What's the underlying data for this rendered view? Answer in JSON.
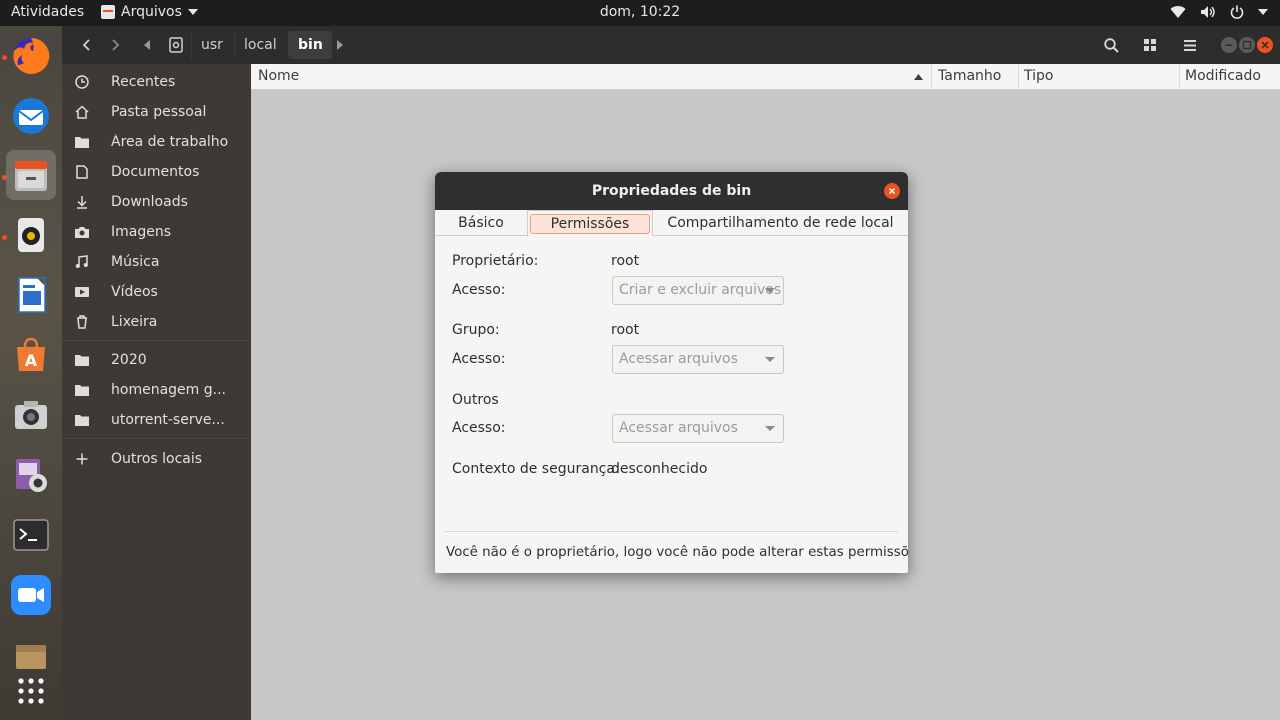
{
  "topbar": {
    "activities": "Atividades",
    "app_menu": "Arquivos",
    "clock": "dom, 10:22"
  },
  "dock": {
    "items": [
      "firefox-icon",
      "thunderbird-icon",
      "files-icon",
      "rhythmbox-icon",
      "libreoffice-writer-icon",
      "ubuntu-software-icon",
      "screenshot-icon",
      "cheese-icon",
      "terminal-icon",
      "zoom-icon",
      "archive-icon",
      "show-apps-icon"
    ]
  },
  "nav": {
    "breadcrumbs": [
      "usr",
      "local",
      "bin"
    ]
  },
  "sidebar": {
    "items": [
      {
        "label": "Recentes",
        "icon": "clock-icon"
      },
      {
        "label": "Pasta pessoal",
        "icon": "home-icon"
      },
      {
        "label": "Área de trabalho",
        "icon": "folder-icon"
      },
      {
        "label": "Documentos",
        "icon": "document-icon"
      },
      {
        "label": "Downloads",
        "icon": "download-icon"
      },
      {
        "label": "Imagens",
        "icon": "camera-icon"
      },
      {
        "label": "Música",
        "icon": "music-icon"
      },
      {
        "label": "Vídeos",
        "icon": "video-icon"
      },
      {
        "label": "Lixeira",
        "icon": "trash-icon"
      }
    ],
    "bookmarks": [
      {
        "label": "2020",
        "icon": "folder-icon"
      },
      {
        "label": "homenagem g...",
        "icon": "folder-icon"
      },
      {
        "label": "utorrent-serve...",
        "icon": "folder-icon"
      }
    ],
    "other_locations": "Outros locais"
  },
  "columns": {
    "name": "Nome",
    "size": "Tamanho",
    "type": "Tipo",
    "modified": "Modificado"
  },
  "dialog": {
    "title": "Propriedades de bin",
    "tabs": [
      "Básico",
      "Permissões",
      "Compartilhamento de rede local"
    ],
    "selected_tab": "Permissões",
    "owner_label": "Proprietário:",
    "owner_value": "root",
    "owner_access_label": "Acesso:",
    "owner_access_value": "Criar e excluir arquivos",
    "group_label": "Grupo:",
    "group_value": "root",
    "group_access_label": "Acesso:",
    "group_access_value": "Acessar arquivos",
    "others_label": "Outros",
    "others_access_label": "Acesso:",
    "others_access_value": "Acessar arquivos",
    "security_label": "Contexto de segurança:",
    "security_value": "desconhecido",
    "footer": "Você não é o proprietário, logo você não pode alterar estas permissões."
  },
  "colors": {
    "accent": "#e95420",
    "topbar": "#1d1d1d",
    "sidebar": "#3d3a36",
    "headerbar": "#2d2d2d"
  }
}
